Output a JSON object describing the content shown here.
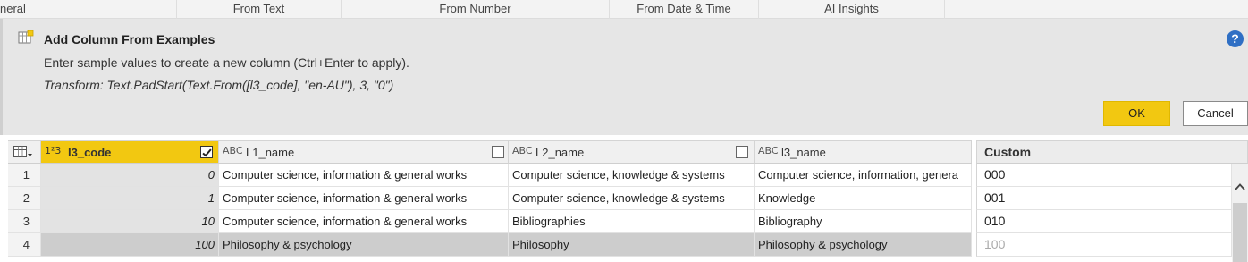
{
  "ribbon": {
    "groups": [
      "neral",
      "From Text",
      "From Number",
      "From Date & Time",
      "AI Insights"
    ]
  },
  "pane": {
    "icon": "add-column-icon",
    "title": "Add Column From Examples",
    "description": "Enter sample values to create a new column (Ctrl+Enter to apply).",
    "transform": "Transform: Text.PadStart(Text.From([l3_code], \"en-AU\"), 3, \"0\")",
    "help_icon": "help-icon",
    "help_label": "?",
    "ok_label": "OK",
    "cancel_label": "Cancel",
    "accent_color": "#f2c811",
    "help_color": "#2f6fc4"
  },
  "grid": {
    "columns": [
      {
        "name": "l3_code",
        "type_icon": "1²3",
        "checked": true
      },
      {
        "name": "L1_name",
        "type_icon": "ABC",
        "checked": false
      },
      {
        "name": "L2_name",
        "type_icon": "ABC",
        "checked": false
      },
      {
        "name": "l3_name",
        "type_icon": "ABC",
        "checked": false
      }
    ],
    "custom_column": "Custom",
    "rows": [
      {
        "num": "1",
        "l3_code": "0",
        "L1_name": "Computer science, information & general works",
        "L2_name": "Computer science, knowledge & systems",
        "l3_name": "Computer science, information, genera",
        "custom": "000"
      },
      {
        "num": "2",
        "l3_code": "1",
        "L1_name": "Computer science, information & general works",
        "L2_name": "Computer science, knowledge & systems",
        "l3_name": "Knowledge",
        "custom": "001"
      },
      {
        "num": "3",
        "l3_code": "10",
        "L1_name": "Computer science, information & general works",
        "L2_name": "Bibliographies",
        "l3_name": "Bibliography",
        "custom": "010"
      },
      {
        "num": "4",
        "l3_code": "100",
        "L1_name": "Philosophy & psychology",
        "L2_name": "Philosophy",
        "l3_name": "Philosophy & psychology",
        "custom": "100"
      }
    ]
  }
}
